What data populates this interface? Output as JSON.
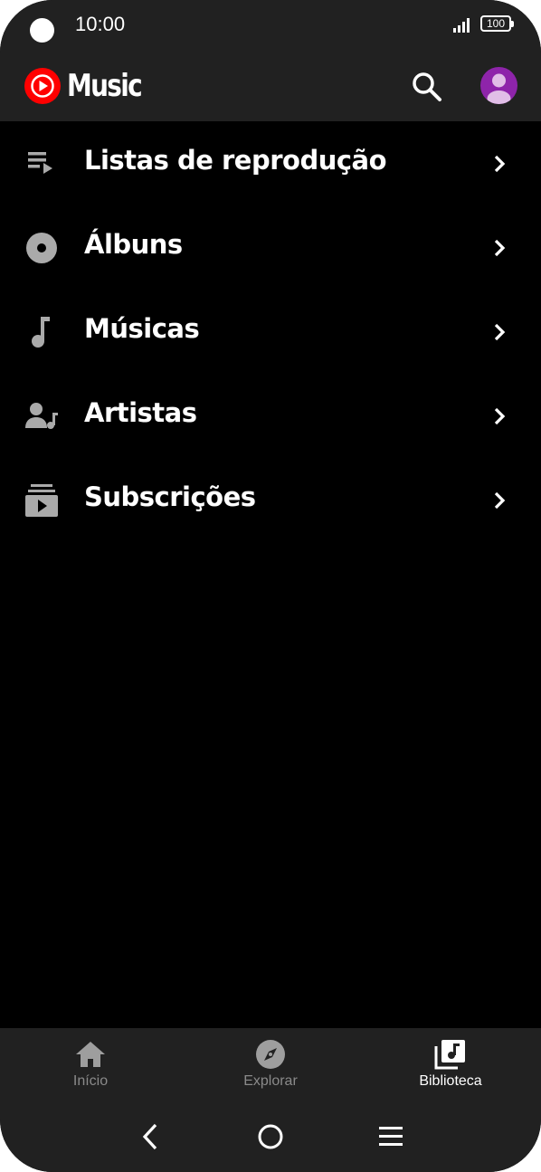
{
  "status_bar": {
    "time": "10:00",
    "battery": "100"
  },
  "app_bar": {
    "logo_text": "Music",
    "brand_color": "#ff0000"
  },
  "library": {
    "items": [
      {
        "label": "Listas de reprodução",
        "icon": "playlist-icon"
      },
      {
        "label": "Álbuns",
        "icon": "album-icon"
      },
      {
        "label": "Músicas",
        "icon": "music-note-icon"
      },
      {
        "label": "Artistas",
        "icon": "artist-icon"
      },
      {
        "label": "Subscrições",
        "icon": "subscriptions-icon"
      }
    ]
  },
  "bottom_nav": {
    "items": [
      {
        "label": "Início",
        "icon": "home-icon",
        "active": false
      },
      {
        "label": "Explorar",
        "icon": "compass-icon",
        "active": false
      },
      {
        "label": "Biblioteca",
        "icon": "library-icon",
        "active": true
      }
    ]
  },
  "system_nav": [
    "back-icon",
    "home-circle-icon",
    "menu-icon"
  ],
  "colors": {
    "background": "#000000",
    "surface": "#212121",
    "text": "#ffffff",
    "icon_muted": "#aaaaaa",
    "inactive_label": "#8a8a8a",
    "avatar": "#8e24aa"
  }
}
